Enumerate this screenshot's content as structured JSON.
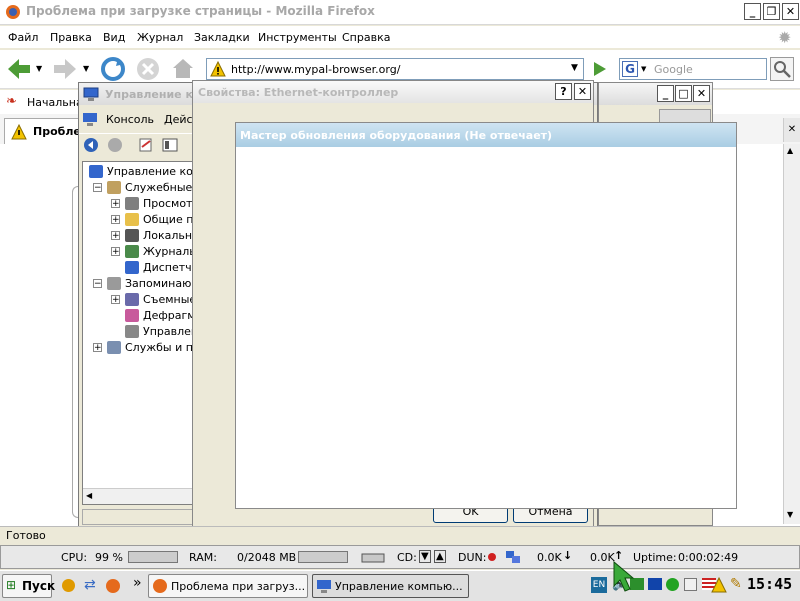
{
  "firefox": {
    "title": "Проблема при загрузке страницы - Mozilla Firefox",
    "menu": [
      "Файл",
      "Правка",
      "Вид",
      "Журнал",
      "Закладки",
      "Инструменты",
      "Справка"
    ],
    "url": "http://www.mypal-browser.org/",
    "search_placeholder": "Google",
    "bookmark": "Начальна",
    "tab": "Проблем",
    "status": "Готово"
  },
  "mmc": {
    "title": "Управление ко",
    "menu": [
      "Консоль",
      "Дейст"
    ],
    "tree": [
      {
        "label": "Управление комп",
        "level": 0,
        "expander": "",
        "icon": "computer-icon"
      },
      {
        "label": "Служебные п",
        "level": 1,
        "expander": "−",
        "icon": "tools-icon"
      },
      {
        "label": "Просмотр",
        "level": 2,
        "expander": "+",
        "icon": "event-viewer-icon"
      },
      {
        "label": "Общие па",
        "level": 2,
        "expander": "+",
        "icon": "shared-folder-icon"
      },
      {
        "label": "Локальнь",
        "level": 2,
        "expander": "+",
        "icon": "users-icon"
      },
      {
        "label": "Журналы",
        "level": 2,
        "expander": "+",
        "icon": "performance-log-icon"
      },
      {
        "label": "Диспетче",
        "level": 2,
        "expander": "",
        "icon": "device-manager-icon"
      },
      {
        "label": "Запоминающ",
        "level": 1,
        "expander": "−",
        "icon": "storage-icon"
      },
      {
        "label": "Съемные",
        "level": 2,
        "expander": "+",
        "icon": "removable-storage-icon"
      },
      {
        "label": "Дефрагме",
        "level": 2,
        "expander": "",
        "icon": "defrag-icon"
      },
      {
        "label": "Управлен",
        "level": 2,
        "expander": "",
        "icon": "disk-management-icon"
      },
      {
        "label": "Службы и при",
        "level": 1,
        "expander": "+",
        "icon": "services-icon"
      }
    ]
  },
  "props": {
    "title": "Свойства: Ethernet-контроллер",
    "help": "?",
    "close": "✕",
    "ok": "OK",
    "cancel": "Отмена"
  },
  "wizard": {
    "title": "Мастер обновления оборудования (Не отвечает)"
  },
  "sysbar": {
    "cpu_label": "CPU:",
    "cpu_value": "99 %",
    "ram_label": "RAM:",
    "ram_value": "0/2048 MB",
    "cd_label": "CD:",
    "dun_label": "DUN:",
    "down": "0.0K",
    "up": "0.0K",
    "uptime_label": "Uptime:",
    "uptime_value": "0:00:02:49"
  },
  "taskbar": {
    "start": "Пуск",
    "chevron": "»",
    "tasks": [
      "Проблема при загруз...",
      "Управление компью..."
    ],
    "lang": "EN",
    "clock": "15:45"
  },
  "colors": {
    "wizard_title": "#a9cde3",
    "accent": "#316ac5"
  }
}
